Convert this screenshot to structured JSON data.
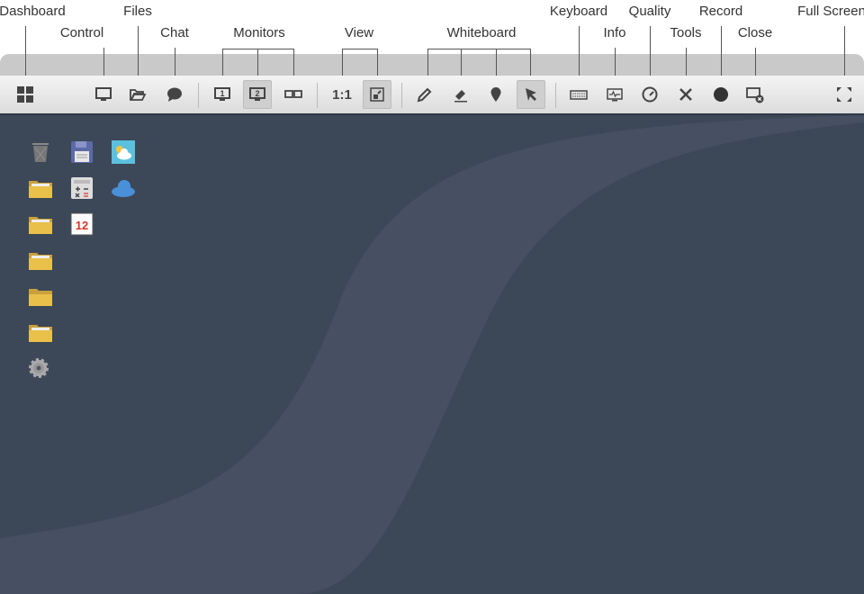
{
  "labels": {
    "dashboard": "Dashboard",
    "control": "Control",
    "files": "Files",
    "chat": "Chat",
    "monitors": "Monitors",
    "view": "View",
    "whiteboard": "Whiteboard",
    "keyboard": "Keyboard",
    "info": "Info",
    "quality": "Quality",
    "tools": "Tools",
    "record": "Record",
    "close": "Close",
    "fullscreen": "Full Screen"
  },
  "toolbar": {
    "view_1to1": "1:1",
    "monitor1": "1",
    "monitor2": "2",
    "active": [
      "monitor-2",
      "view-fit",
      "pointer"
    ]
  },
  "desktop": {
    "calendar_day": "12",
    "icons": [
      "trash",
      "floppy",
      "weather",
      "folder",
      "calculator",
      "cloud",
      "folder",
      "calendar",
      "folder",
      "folder",
      "folder",
      "settings"
    ]
  },
  "colors": {
    "desktop": "#3c4858",
    "swoosh": "#474f62",
    "folder": "#e8c04a",
    "cloud": "#4a90d9",
    "record": "#333333"
  }
}
